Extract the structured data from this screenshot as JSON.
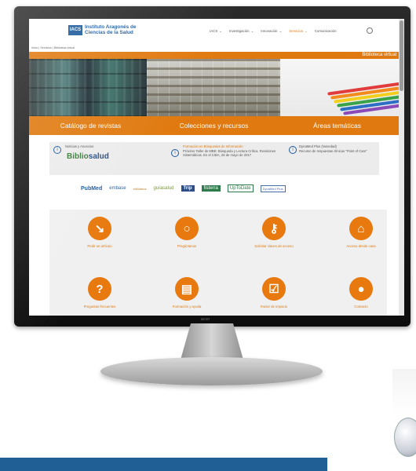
{
  "site": {
    "logo_abbr": "IACS",
    "logo_name": "Instituto Aragonés de Ciencias de la Salud",
    "nav": [
      "IACS",
      "Investigación",
      "Innovación",
      "Servicios",
      "Comunicación"
    ],
    "nav_active_index": 3,
    "breadcrumb": "Inicio | Servicios | Biblioteca virtual",
    "section_title": "Biblioteca virtual",
    "categories": [
      "Catálogo de revistas",
      "Colecciones y recursos",
      "Áreas temáticas"
    ],
    "news": {
      "col1_title": "Noticias y Anuncios",
      "bibliosalud_a": "Biblio",
      "bibliosalud_b": "salud",
      "col2_title": "Formación en Búsquedas de Información",
      "col2_text": "Próximo Taller de MBE: Búsqueda y Lectura Crítica. Revisiones Sistemáticas. En el CIBA, 26 de mayo de 2017",
      "col3_title": "DynaMed Plus (Novedad)",
      "col3_text": "Recurso de respuestas clínicas \"Point of Care\""
    },
    "resources": [
      "PubMed",
      "embase",
      "biblioteca",
      "guíasalud",
      "Trip",
      "fisterra",
      "UpToDate",
      "DynaMed Plus"
    ],
    "tiles": [
      {
        "label": "Pedir un artículo",
        "icon": "external-link-icon",
        "glyph": "↘"
      },
      {
        "label": "Pregúntanos",
        "icon": "speech-bubble-icon",
        "glyph": "○"
      },
      {
        "label": "Solicitar claves de acceso",
        "icon": "key-icon",
        "glyph": "⚷"
      },
      {
        "label": "Acceso desde casa",
        "icon": "home-icon",
        "glyph": "⌂"
      },
      {
        "label": "Preguntas frecuentes",
        "icon": "question-icon",
        "glyph": "?"
      },
      {
        "label": "Formación y ayuda",
        "icon": "document-icon",
        "glyph": "▤"
      },
      {
        "label": "Factor de impacto",
        "icon": "checkbox-icon",
        "glyph": "☑"
      },
      {
        "label": "Contacto",
        "icon": "person-icon",
        "glyph": "●"
      }
    ]
  },
  "colors": {
    "orange": "#e07a10",
    "blue": "#1d5a9c"
  }
}
